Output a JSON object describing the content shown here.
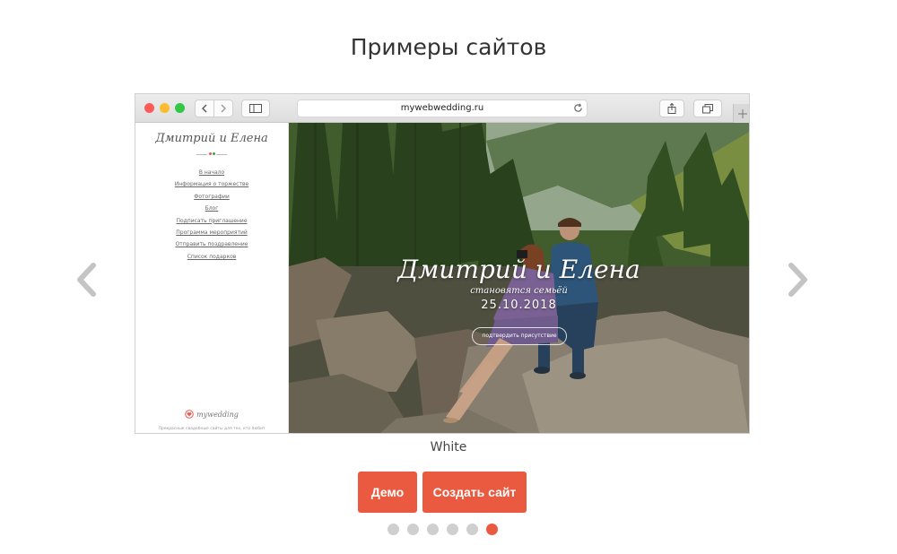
{
  "page": {
    "title": "Примеры сайтов"
  },
  "browser": {
    "url": "mywebwedding.ru"
  },
  "preview_site": {
    "logo": "Дмитрий и Елена",
    "nav": [
      "В начало",
      "Информация о торжестве",
      "Фотографии",
      "Блог",
      "Подписать приглашение",
      "Программа мероприятий",
      "Отправить поздравление",
      "Список подарков"
    ],
    "footer_logo": "mywedding",
    "footer_text": "Прекрасные свадебные сайты для тех, кто любит",
    "hero": {
      "names": "Дмитрий и Елена",
      "subtitle": "становятся семьёй",
      "date": "25.10.2018",
      "button": "подтвердить присутствие"
    }
  },
  "slide": {
    "caption": "White",
    "demo_label": "Демо",
    "create_label": "Создать сайт",
    "total": 6,
    "current": 6
  },
  "colors": {
    "accent": "#ea5a40",
    "dot_inactive": "#cfcfcf"
  }
}
